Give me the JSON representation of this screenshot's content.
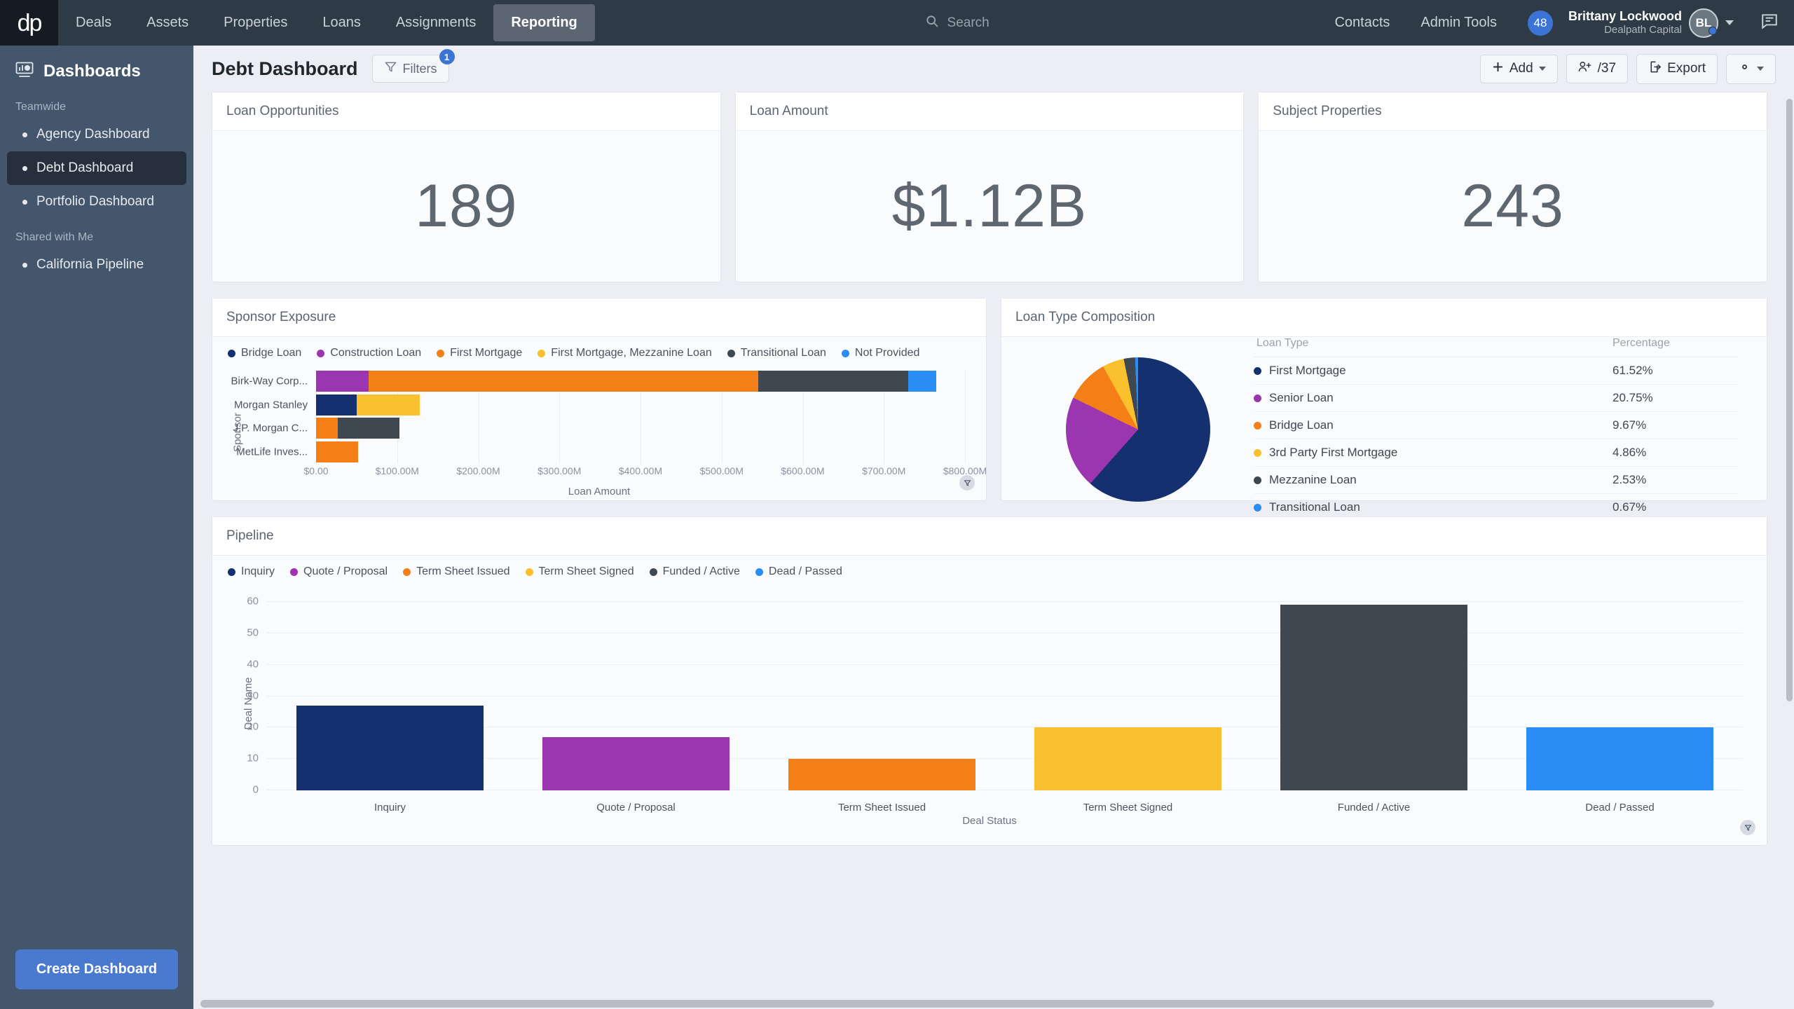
{
  "topnav": {
    "logo": "dp",
    "items": [
      {
        "label": "Deals",
        "active": false
      },
      {
        "label": "Assets",
        "active": false
      },
      {
        "label": "Properties",
        "active": false
      },
      {
        "label": "Loans",
        "active": false
      },
      {
        "label": "Assignments",
        "active": false
      },
      {
        "label": "Reporting",
        "active": true
      }
    ],
    "search_placeholder": "Search",
    "right_items": [
      {
        "label": "Contacts"
      },
      {
        "label": "Admin Tools"
      }
    ],
    "notification_count": "48",
    "user_name": "Brittany Lockwood",
    "user_org": "Dealpath Capital",
    "avatar_initials": "BL"
  },
  "sidebar": {
    "title": "Dashboards",
    "groups": [
      {
        "label": "Teamwide",
        "items": [
          {
            "label": "Agency Dashboard",
            "active": false
          },
          {
            "label": "Debt Dashboard",
            "active": true
          },
          {
            "label": "Portfolio Dashboard",
            "active": false
          }
        ]
      },
      {
        "label": "Shared with Me",
        "items": [
          {
            "label": "California Pipeline",
            "active": false
          }
        ]
      }
    ],
    "create_button": "Create Dashboard"
  },
  "header": {
    "title": "Debt Dashboard",
    "filters_label": "Filters",
    "filters_badge": "1",
    "add_label": "Add",
    "share_label": "/37",
    "export_label": "Export"
  },
  "kpis": [
    {
      "title": "Loan Opportunities",
      "value": "189"
    },
    {
      "title": "Loan Amount",
      "value": "$1.12B"
    },
    {
      "title": "Subject Properties",
      "value": "243"
    }
  ],
  "sponsor_panel": {
    "title": "Sponsor Exposure"
  },
  "loantype_panel": {
    "title": "Loan Type Composition"
  },
  "pipeline_panel": {
    "title": "Pipeline"
  },
  "loantype_table": {
    "columns": [
      "Loan Type",
      "Percentage"
    ]
  },
  "chart_data": [
    {
      "type": "bar",
      "orientation": "horizontal",
      "stacked": true,
      "title": "Sponsor Exposure",
      "xlabel": "Loan Amount",
      "ylabel": "Sponsor",
      "xlim": [
        0,
        800000000
      ],
      "xticks": [
        "$0.00",
        "$100.00M",
        "$200.00M",
        "$300.00M",
        "$400.00M",
        "$500.00M",
        "$600.00M",
        "$700.00M",
        "$800.00M"
      ],
      "grid": true,
      "legend_position": "top-left",
      "legend": [
        {
          "name": "Bridge Loan",
          "color": "#14306e"
        },
        {
          "name": "Construction Loan",
          "color": "#9b35b0"
        },
        {
          "name": "First Mortgage",
          "color": "#f57f17"
        },
        {
          "name": "First Mortgage, Mezzanine Loan",
          "color": "#fbc02d"
        },
        {
          "name": "Transitional Loan",
          "color": "#3f4850"
        },
        {
          "name": "Not Provided",
          "color": "#2a8cf5"
        }
      ],
      "categories": [
        "Birk-Way Corp...",
        "Morgan Stanley",
        "J.P. Morgan C...",
        "MetLife Inves..."
      ],
      "series": [
        {
          "name": "Bridge Loan",
          "color": "#14306e",
          "values": [
            0,
            50000000,
            0,
            0
          ]
        },
        {
          "name": "Construction Loan",
          "color": "#9b35b0",
          "values": [
            65000000,
            0,
            0,
            0
          ]
        },
        {
          "name": "First Mortgage",
          "color": "#f57f17",
          "values": [
            480000000,
            0,
            27000000,
            52000000
          ]
        },
        {
          "name": "First Mortgage, Mezzanine Loan",
          "color": "#fbc02d",
          "values": [
            0,
            78000000,
            0,
            0
          ]
        },
        {
          "name": "Transitional Loan",
          "color": "#3f4850",
          "values": [
            185000000,
            0,
            76000000,
            0
          ]
        },
        {
          "name": "Not Provided",
          "color": "#2a8cf5",
          "values": [
            35000000,
            0,
            0,
            0
          ]
        }
      ]
    },
    {
      "type": "pie",
      "title": "Loan Type Composition",
      "start_angle": 0,
      "direction": "clockwise",
      "labels": [
        "First Mortgage",
        "Senior Loan",
        "Bridge Loan",
        "3rd Party First Mortgage",
        "Mezzanine Loan",
        "Transitional Loan"
      ],
      "values": [
        61.52,
        20.75,
        9.67,
        4.86,
        2.53,
        0.67
      ],
      "display_values": [
        "61.52%",
        "20.75%",
        "9.67%",
        "4.86%",
        "2.53%",
        "0.67%"
      ],
      "colors": [
        "#14306e",
        "#9b35b0",
        "#f57f17",
        "#fbc02d",
        "#3f4850",
        "#2a8cf5"
      ]
    },
    {
      "type": "bar",
      "orientation": "vertical",
      "title": "Pipeline",
      "xlabel": "Deal Status",
      "ylabel": "Deal Name",
      "ylim": [
        0,
        60
      ],
      "yticks": [
        "0",
        "10",
        "20",
        "30",
        "40",
        "50",
        "60"
      ],
      "grid": true,
      "legend_position": "top-left",
      "legend": [
        {
          "name": "Inquiry",
          "color": "#14306e"
        },
        {
          "name": "Quote / Proposal",
          "color": "#9b35b0"
        },
        {
          "name": "Term Sheet Issued",
          "color": "#f57f17"
        },
        {
          "name": "Term Sheet Signed",
          "color": "#fbc02d"
        },
        {
          "name": "Funded / Active",
          "color": "#3f4850"
        },
        {
          "name": "Dead / Passed",
          "color": "#2a8cf5"
        }
      ],
      "categories": [
        "Inquiry",
        "Quote / Proposal",
        "Term Sheet Issued",
        "Term Sheet Signed",
        "Funded / Active",
        "Dead / Passed"
      ],
      "values": [
        27,
        17,
        10,
        20,
        59,
        20
      ],
      "colors": [
        "#14306e",
        "#9b35b0",
        "#f57f17",
        "#fbc02d",
        "#3f4850",
        "#2a8cf5"
      ]
    }
  ]
}
